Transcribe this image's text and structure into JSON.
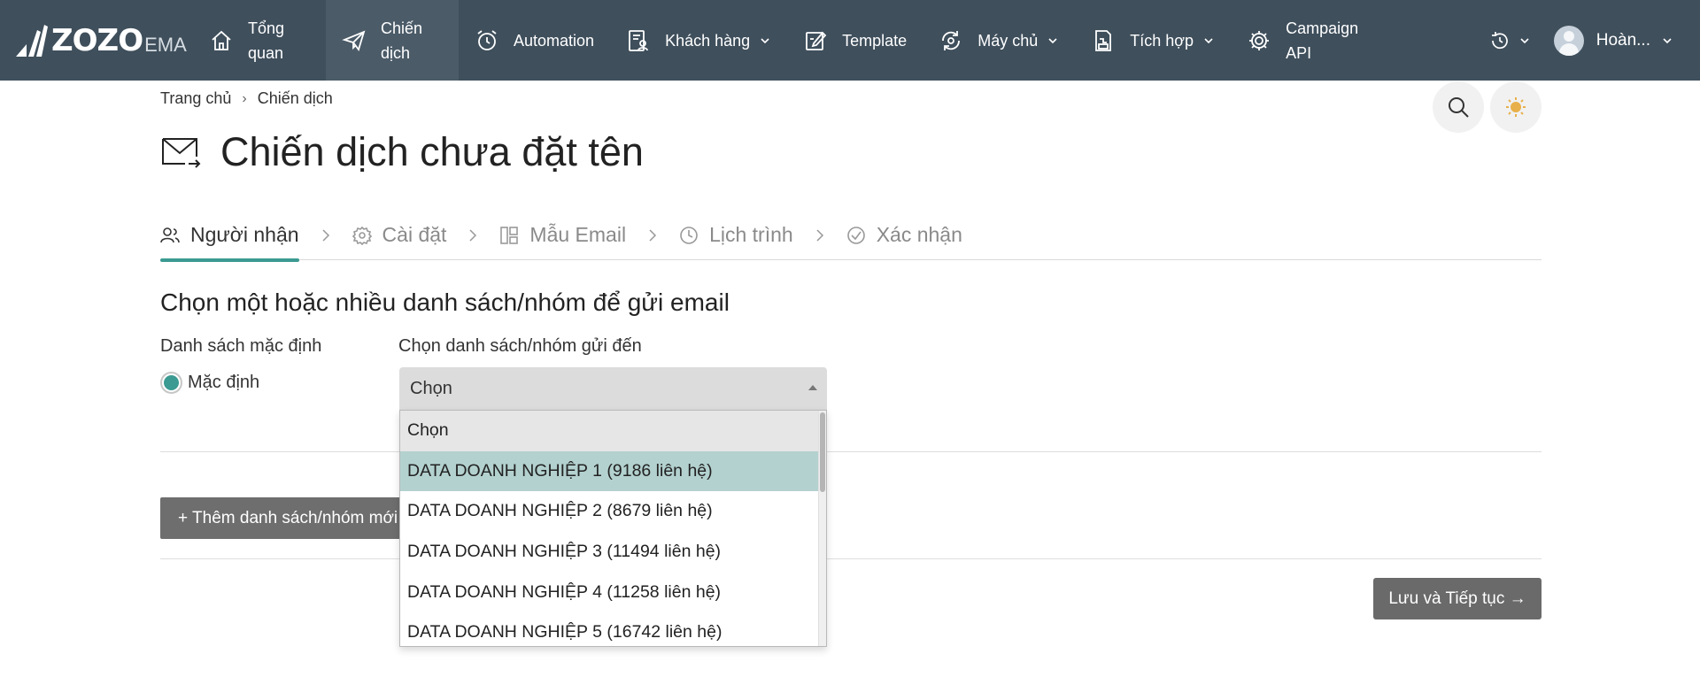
{
  "brand": {
    "logo_text": "ZOZO",
    "logo_sub": "EMA"
  },
  "nav": {
    "items": [
      {
        "label": "Tổng quan",
        "icon": "home-icon"
      },
      {
        "label": "Chiến dịch",
        "icon": "paper-plane-icon",
        "active": true
      },
      {
        "label": "Automation",
        "icon": "alarm-clock-icon"
      },
      {
        "label": "Khách hàng",
        "icon": "contacts-icon",
        "dropdown": true
      },
      {
        "label": "Template",
        "icon": "edit-icon"
      },
      {
        "label": "Máy chủ",
        "icon": "sync-server-icon",
        "dropdown": true
      },
      {
        "label": "Tích hợp",
        "icon": "integration-icon",
        "dropdown": true
      },
      {
        "label": "Campaign API",
        "icon": "api-gear-icon"
      }
    ],
    "user_name": "Hoàn..."
  },
  "breadcrumb": {
    "home": "Trang chủ",
    "current": "Chiến dịch"
  },
  "page": {
    "title": "Chiến dịch chưa đặt tên"
  },
  "steps": [
    {
      "label": "Người nhận",
      "icon": "user-group-icon",
      "active": true
    },
    {
      "label": "Cài đặt",
      "icon": "gear-icon"
    },
    {
      "label": "Mẫu Email",
      "icon": "layout-icon"
    },
    {
      "label": "Lịch trình",
      "icon": "clock-icon"
    },
    {
      "label": "Xác nhận",
      "icon": "check-circle-icon"
    }
  ],
  "form": {
    "section_title": "Chọn một hoặc nhiều danh sách/nhóm để gửi email",
    "default_list_label": "Danh sách mặc định",
    "default_option": "Mặc định",
    "select_label": "Chọn danh sách/nhóm gửi đến",
    "select_value": "Chọn",
    "options": [
      "Chọn",
      "DATA DOANH NGHIỆP 1 (9186 liên hệ)",
      "DATA DOANH NGHIỆP 2 (8679 liên hệ)",
      "DATA DOANH NGHIỆP 3 (11494 liên hệ)",
      "DATA DOANH NGHIỆP 4 (11258 liên hệ)",
      "DATA DOANH NGHIỆP 5 (16742 liên hệ)"
    ],
    "add_button": "+ Thêm danh sách/nhóm mới",
    "save_button": "Lưu và Tiếp tục →"
  },
  "colors": {
    "topbar": "#3f4f5c",
    "accent": "#3b9a92",
    "highlight_option": "#b3d1cf",
    "button": "#6e6e6e"
  }
}
